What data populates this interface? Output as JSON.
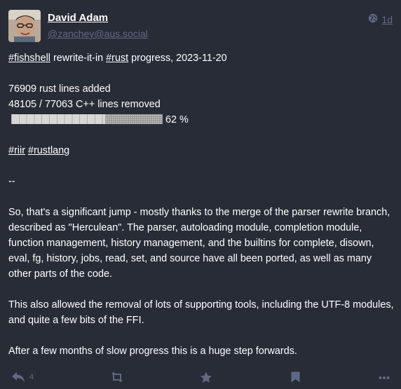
{
  "author": {
    "display_name": "David Adam",
    "handle": "@zanchey@aus.social"
  },
  "meta": {
    "visibility_icon": "globe-icon",
    "time": "1d"
  },
  "content": {
    "line1": {
      "tag1": "#fishshell",
      "text1": " rewrite-it-in ",
      "tag2": "#rust",
      "text2": " progress, 2023-11-20"
    },
    "stats": {
      "rust_lines": "76909 rust lines added",
      "cpp_lines": "48105 / 77063 C++ lines removed",
      "progress_label": "62 %",
      "progress_value": 0.62
    },
    "tags": {
      "tag1": "#riir",
      "tag2": "#rustlang"
    },
    "separator": "--",
    "paragraph1": "So, that's a significant jump - mostly thanks to the merge of the parser rewrite branch, described as \"Herculean\". The parser, autoloading module, completion module, function management, history management, and the builtins for complete, disown, eval, fg, history, jobs, read, set, and source have all been ported, as well as many other parts of the code.",
    "paragraph2": "This also allowed the removal of lots of supporting tools, including the UTF-8 modules, and quite a few bits of the FFI.",
    "paragraph3": "After a few months of slow progress this is a huge step forwards."
  },
  "actions": {
    "reply_count": "4",
    "reply_icon": "reply-icon",
    "boost_icon": "boost-icon",
    "favourite_icon": "star-icon",
    "bookmark_icon": "bookmark-icon",
    "more_icon": "more-icon"
  },
  "colors": {
    "background": "#282c37",
    "muted": "#606984",
    "text": "#ffffff"
  }
}
